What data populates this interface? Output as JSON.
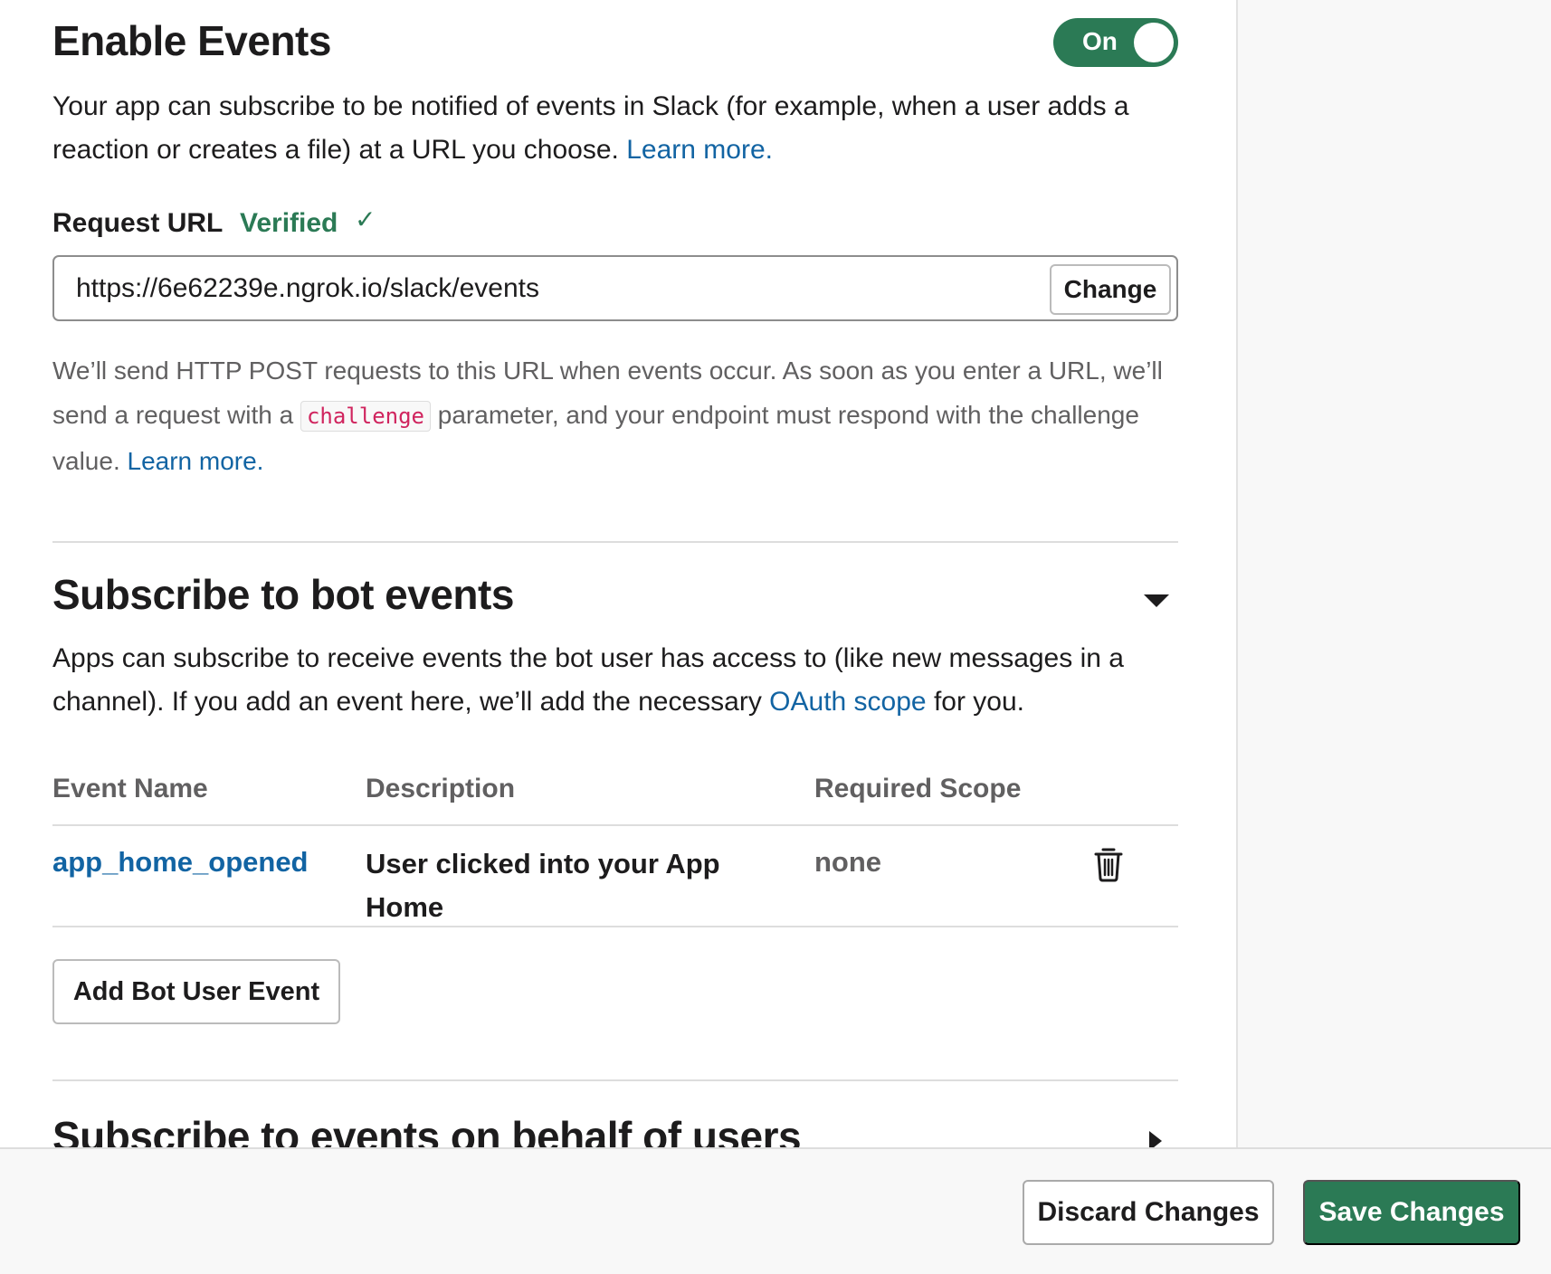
{
  "enable_events": {
    "title": "Enable Events",
    "toggle_label": "On",
    "description_text": "Your app can subscribe to be notified of events in Slack (for example, when a user adds a reaction or creates a file) at a URL you choose.",
    "learn_more": "Learn more."
  },
  "request_url": {
    "label": "Request URL",
    "status": "Verified",
    "check_glyph": "✓",
    "value": "https://6e62239e.ngrok.io/slack/events",
    "change_button": "Change",
    "help_part1": "We’ll send HTTP POST requests to this URL when events occur. As soon as you enter a URL, we’ll send a request with a",
    "help_code": "challenge",
    "help_part2": "parameter, and your endpoint must respond with the challenge value.",
    "learn_more": "Learn more."
  },
  "bot_events": {
    "title": "Subscribe to bot events",
    "description_part1": "Apps can subscribe to receive events the bot user has access to (like new messages in a channel). If you add an event here, we’ll add the necessary",
    "oauth_link": "OAuth scope",
    "description_part2": "for you.",
    "columns": [
      "Event Name",
      "Description",
      "Required Scope"
    ],
    "rows": [
      {
        "event_name": "app_home_opened",
        "description": "User clicked into your App Home",
        "scope": "none"
      }
    ],
    "add_button": "Add Bot User Event"
  },
  "user_events": {
    "title": "Subscribe to events on behalf of users"
  },
  "footer": {
    "discard": "Discard Changes",
    "save": "Save Changes"
  },
  "colors": {
    "accent_green": "#2b7a55",
    "link_blue": "#1264a3",
    "code_red": "#d0245e"
  },
  "icons": {
    "toggle": "toggle-on-icon",
    "verified": "check-icon",
    "section_open": "caret-down-icon",
    "section_closed": "caret-right-icon",
    "delete": "trash-icon"
  }
}
